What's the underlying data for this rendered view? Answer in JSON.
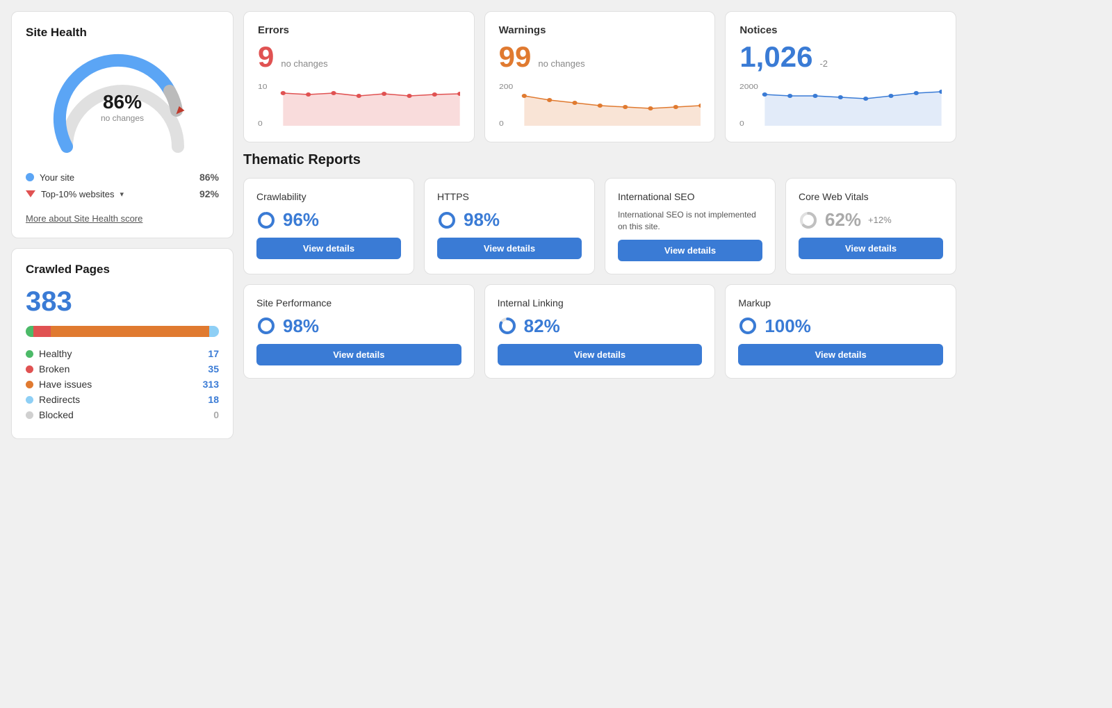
{
  "siteHealth": {
    "title": "Site Health",
    "percent": "86%",
    "label": "no changes",
    "yourSiteLabel": "Your site",
    "yourSiteValue": "86%",
    "topSitesLabel": "Top-10% websites",
    "topSitesValue": "92%",
    "moreLink": "More about Site Health score",
    "gaugePercent": 86
  },
  "crawledPages": {
    "title": "Crawled Pages",
    "total": "383",
    "legend": [
      {
        "label": "Healthy",
        "count": "17",
        "color": "#4cba68"
      },
      {
        "label": "Broken",
        "count": "35",
        "color": "#e05252"
      },
      {
        "label": "Have issues",
        "count": "313",
        "color": "#e07a30"
      },
      {
        "label": "Redirects",
        "count": "18",
        "color": "#8ecff5"
      },
      {
        "label": "Blocked",
        "count": "0",
        "color": "#d0d0d0"
      }
    ],
    "barSegments": [
      {
        "color": "#4cba68",
        "pct": 4
      },
      {
        "color": "#e05252",
        "pct": 9
      },
      {
        "color": "#e07a30",
        "pct": 82
      },
      {
        "color": "#8ecff5",
        "pct": 5
      }
    ]
  },
  "errors": {
    "title": "Errors",
    "count": "9",
    "change": "no changes",
    "chartMax": "10",
    "chartMin": "0"
  },
  "warnings": {
    "title": "Warnings",
    "count": "99",
    "change": "no changes",
    "chartMax": "200",
    "chartMin": "0"
  },
  "notices": {
    "title": "Notices",
    "count": "1,026",
    "change": "-2",
    "chartMax": "2000",
    "chartMin": "0"
  },
  "thematic": {
    "title": "Thematic Reports",
    "row1": [
      {
        "title": "Crawlability",
        "percent": "96%",
        "change": "",
        "donutColor": "#3a7bd5",
        "donutPct": 96,
        "note": "",
        "btnLabel": "View details"
      },
      {
        "title": "HTTPS",
        "percent": "98%",
        "change": "",
        "donutColor": "#3a7bd5",
        "donutPct": 98,
        "note": "",
        "btnLabel": "View details"
      },
      {
        "title": "International SEO",
        "percent": "",
        "change": "",
        "donutColor": "#ccc",
        "donutPct": 0,
        "note": "International SEO is not implemented on this site.",
        "btnLabel": "View details"
      },
      {
        "title": "Core Web Vitals",
        "percent": "62%",
        "change": "+12%",
        "donutColor": "#c0c0c0",
        "donutPct": 62,
        "note": "",
        "btnLabel": "View details"
      }
    ],
    "row2": [
      {
        "title": "Site Performance",
        "percent": "98%",
        "change": "",
        "donutColor": "#3a7bd5",
        "donutPct": 98,
        "note": "",
        "btnLabel": "View details"
      },
      {
        "title": "Internal Linking",
        "percent": "82%",
        "change": "",
        "donutColor": "#3a7bd5",
        "donutPct": 82,
        "note": "",
        "btnLabel": "View details"
      },
      {
        "title": "Markup",
        "percent": "100%",
        "change": "",
        "donutColor": "#3a7bd5",
        "donutPct": 100,
        "note": "",
        "btnLabel": "View details"
      }
    ]
  }
}
